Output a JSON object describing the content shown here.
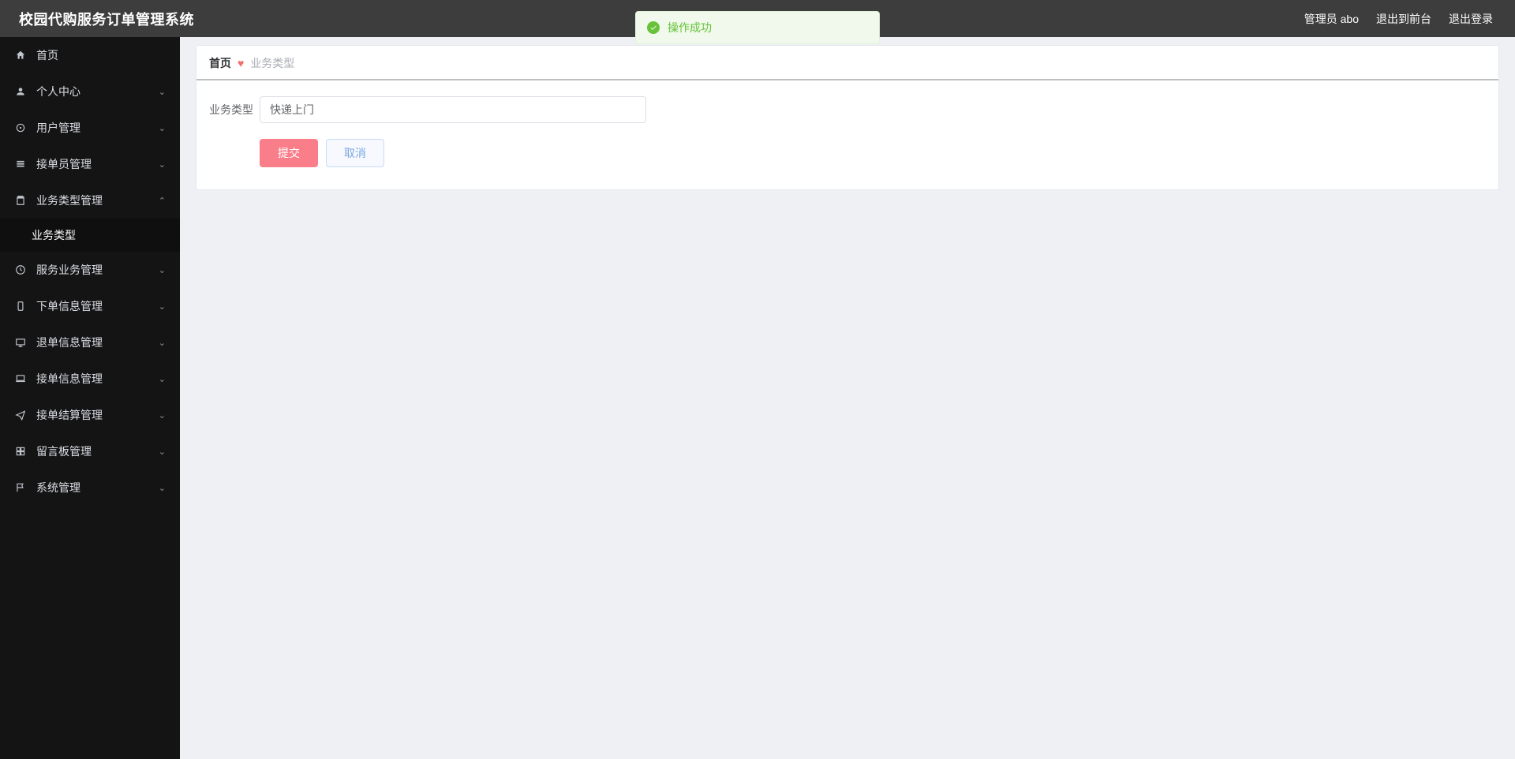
{
  "header": {
    "title": "校园代购服务订单管理系统",
    "admin_label": "管理员 abo",
    "exit_front": "退出到前台",
    "logout": "退出登录"
  },
  "toast": {
    "text": "操作成功"
  },
  "sidebar": {
    "items": [
      {
        "label": "首页",
        "has_arrow": false
      },
      {
        "label": "个人中心",
        "has_arrow": true
      },
      {
        "label": "用户管理",
        "has_arrow": true
      },
      {
        "label": "接单员管理",
        "has_arrow": true
      },
      {
        "label": "业务类型管理",
        "has_arrow": true,
        "expanded": true,
        "children": [
          {
            "label": "业务类型"
          }
        ]
      },
      {
        "label": "服务业务管理",
        "has_arrow": true
      },
      {
        "label": "下单信息管理",
        "has_arrow": true
      },
      {
        "label": "退单信息管理",
        "has_arrow": true
      },
      {
        "label": "接单信息管理",
        "has_arrow": true
      },
      {
        "label": "接单结算管理",
        "has_arrow": true
      },
      {
        "label": "留言板管理",
        "has_arrow": true
      },
      {
        "label": "系统管理",
        "has_arrow": true
      }
    ]
  },
  "breadcrumb": {
    "home": "首页",
    "current": "业务类型"
  },
  "form": {
    "label": "业务类型",
    "value": "快递上门",
    "submit": "提交",
    "cancel": "取消"
  }
}
